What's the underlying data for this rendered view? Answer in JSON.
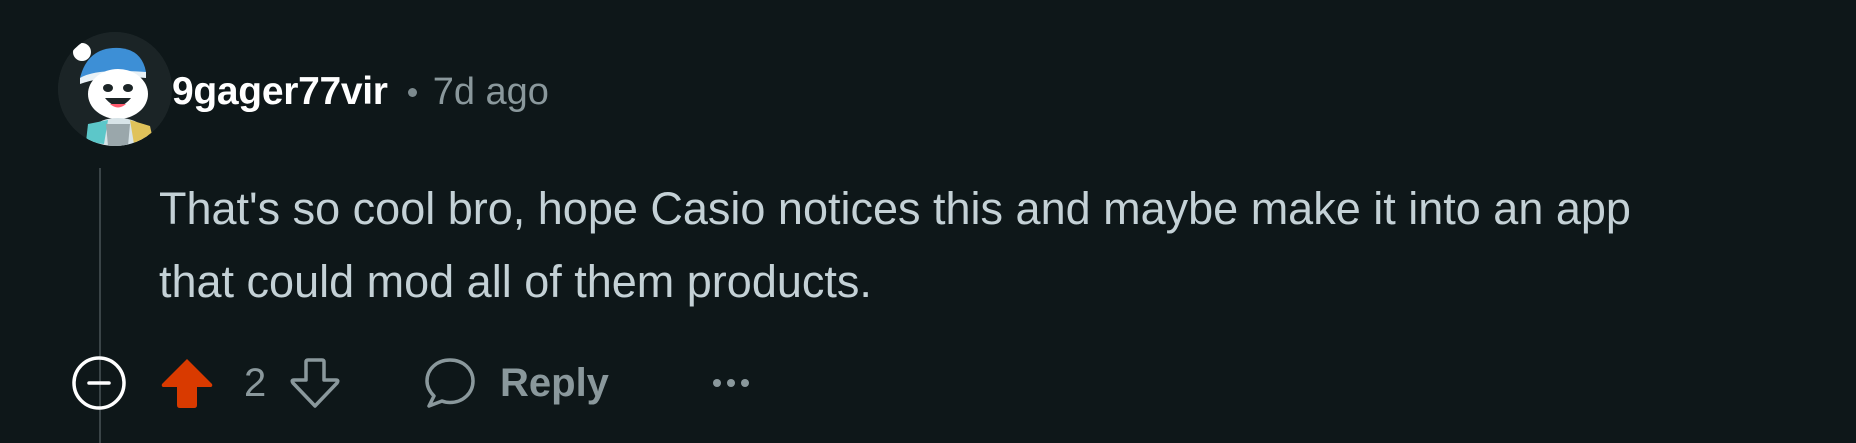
{
  "comment": {
    "author": "9gager77vir",
    "age": "7d ago",
    "body_lines": [
      "That's so cool bro, hope Casio notices this and maybe make it into an app",
      "that could mod all of them products."
    ],
    "score": "2",
    "upvoted": true
  },
  "actions": {
    "reply_label": "Reply"
  },
  "icons": {
    "collapse": "minus-circle-icon",
    "upvote": "arrow-up-icon",
    "downvote": "arrow-down-icon",
    "reply": "speech-bubble-icon",
    "more": "ellipsis-icon"
  },
  "colors": {
    "background": "#0e1719",
    "upvote_active": "#d93a00",
    "muted_text": "#8a989c",
    "body_text": "#c4d1d6",
    "username": "#ffffff"
  }
}
